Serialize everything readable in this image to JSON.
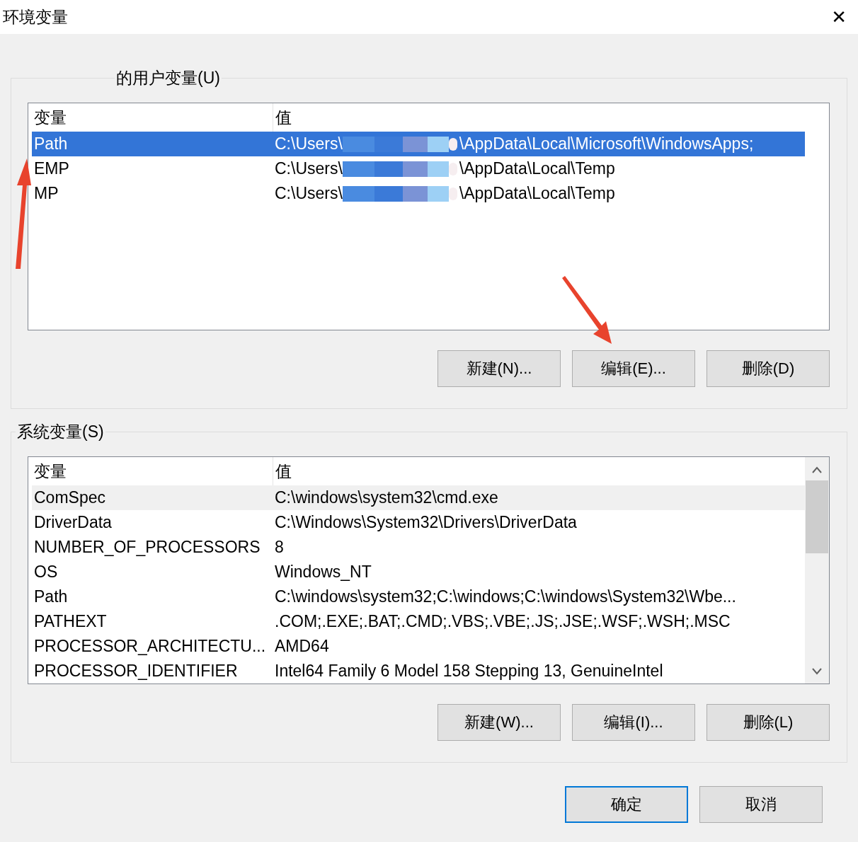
{
  "window": {
    "title": "环境变量",
    "close": "✕"
  },
  "user_group": {
    "title": "的用户变量(U)",
    "columns": [
      "变量",
      "值"
    ],
    "rows": [
      {
        "name": "Path",
        "value_start": "C:\\Users\\",
        "value_end": "\\AppData\\Local\\Microsoft\\WindowsApps;",
        "selected": true
      },
      {
        "name": "EMP",
        "value_start": "C:\\Users\\",
        "value_end": "\\AppData\\Local\\Temp",
        "selected": false
      },
      {
        "name": "MP",
        "value_start": "C:\\Users\\",
        "value_end": "\\AppData\\Local\\Temp",
        "selected": false
      }
    ],
    "buttons": [
      "新建(N)...",
      "编辑(E)...",
      "删除(D)"
    ]
  },
  "system_group": {
    "title": "系统变量(S)",
    "columns": [
      "变量",
      "值"
    ],
    "rows": [
      {
        "name": "ComSpec",
        "value": "C:\\windows\\system32\\cmd.exe",
        "selected": true
      },
      {
        "name": "DriverData",
        "value": "C:\\Windows\\System32\\Drivers\\DriverData",
        "selected": false
      },
      {
        "name": "NUMBER_OF_PROCESSORS",
        "value": "8",
        "selected": false
      },
      {
        "name": "OS",
        "value": "Windows_NT",
        "selected": false
      },
      {
        "name": "Path",
        "value": "C:\\windows\\system32;C:\\windows;C:\\windows\\System32\\Wbe...",
        "selected": false
      },
      {
        "name": "PATHEXT",
        "value": ".COM;.EXE;.BAT;.CMD;.VBS;.VBE;.JS;.JSE;.WSF;.WSH;.MSC",
        "selected": false
      },
      {
        "name": "PROCESSOR_ARCHITECTU...",
        "value": "AMD64",
        "selected": false
      },
      {
        "name": "PROCESSOR_IDENTIFIER",
        "value": "Intel64 Family 6 Model 158 Stepping 13, GenuineIntel",
        "selected": false
      }
    ],
    "buttons": [
      "新建(W)...",
      "编辑(I)...",
      "删除(L)"
    ]
  },
  "footer_buttons": [
    {
      "label": "确定",
      "default": true
    },
    {
      "label": "取消",
      "default": false
    }
  ]
}
